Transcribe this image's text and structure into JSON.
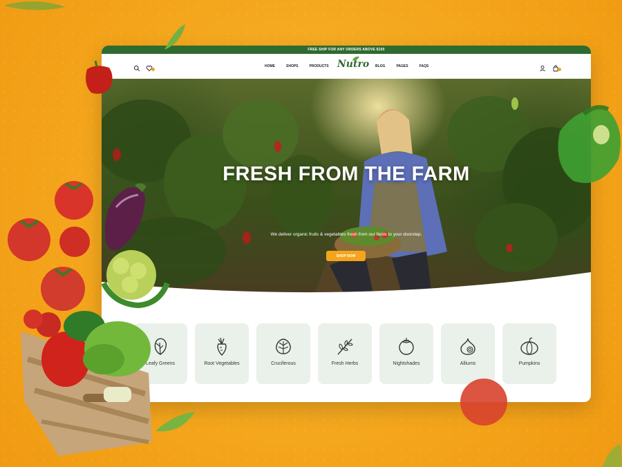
{
  "topbar": {
    "promo": "FREE SHIP FOR ANY ORDERS ABOVE $100"
  },
  "nav": {
    "left_links": [
      "HOME",
      "SHOPS",
      "PRODUCTS"
    ],
    "right_links": [
      "BLOG",
      "PAGES",
      "FAQS"
    ],
    "logo": "Nutro"
  },
  "hero": {
    "title": "FRESH FROM THE FARM",
    "subtitle": "We deliver organic fruits & vegetables fresh from our fields to your doorstep.",
    "cta": "SHOP NOW"
  },
  "categories": [
    {
      "label": "Leafy Greens",
      "icon": "leafy-greens-icon"
    },
    {
      "label": "Root Vegetables",
      "icon": "root-vegetables-icon"
    },
    {
      "label": "Cruciferous",
      "icon": "cruciferous-icon"
    },
    {
      "label": "Fresh Herbs",
      "icon": "herbs-icon"
    },
    {
      "label": "Nightshades",
      "icon": "tomato-icon"
    },
    {
      "label": "Alliums",
      "icon": "onion-icon"
    },
    {
      "label": "Pumpkins",
      "icon": "pumpkin-icon"
    }
  ],
  "colors": {
    "brand": "#2f6b2f",
    "accent": "#f4a51b",
    "background": "#f4a51b"
  }
}
